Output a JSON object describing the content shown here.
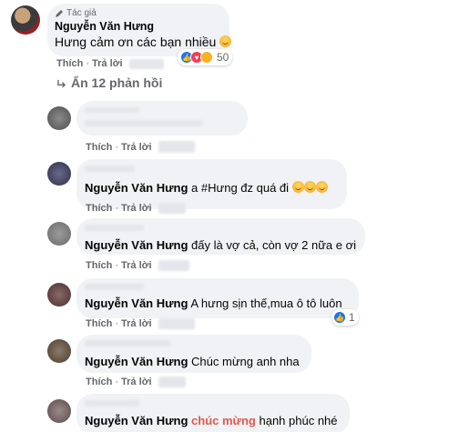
{
  "top_comment": {
    "author_badge": "Tác giả",
    "author": "Nguyễn Văn Hưng",
    "text": "Hưng cảm ơn các bạn nhiều",
    "reaction_count": "50",
    "actions": {
      "like": "Thích",
      "reply": "Trả lời",
      "separator": "·"
    }
  },
  "hide_replies": "Ẩn 12 phản hồi",
  "replies": [
    {
      "author": "",
      "text": "",
      "like": "Thích",
      "reply": "Trả lời"
    },
    {
      "author": "Nguyễn Văn Hưng",
      "text": "a #Hưng đz quá đi",
      "like": "Thích",
      "reply": "Trả lời"
    },
    {
      "author": "Nguyễn Văn Hưng",
      "text": "đấy là vợ cả, còn vợ 2 nữa e ơi",
      "like": "Thích",
      "reply": "Trả lời"
    },
    {
      "author": "Nguyễn Văn Hưng",
      "text": "A hưng sịn thế,mua ô tô luôn",
      "like": "Thích",
      "reply": "Trả lời",
      "like_count": "1"
    },
    {
      "author": "Nguyễn Văn Hưng",
      "text": "Chúc mừng anh nha",
      "like": "Thích",
      "reply": "Trả lời"
    },
    {
      "author": "Nguyễn Văn Hưng",
      "text_highlight": "chúc mừng",
      "text": "hạnh phúc nhé"
    }
  ],
  "colors": {
    "bubble": "#f0f2f5",
    "secondary_text": "#65676b",
    "like_blue": "#1877f2",
    "highlight": "#e2574c"
  }
}
